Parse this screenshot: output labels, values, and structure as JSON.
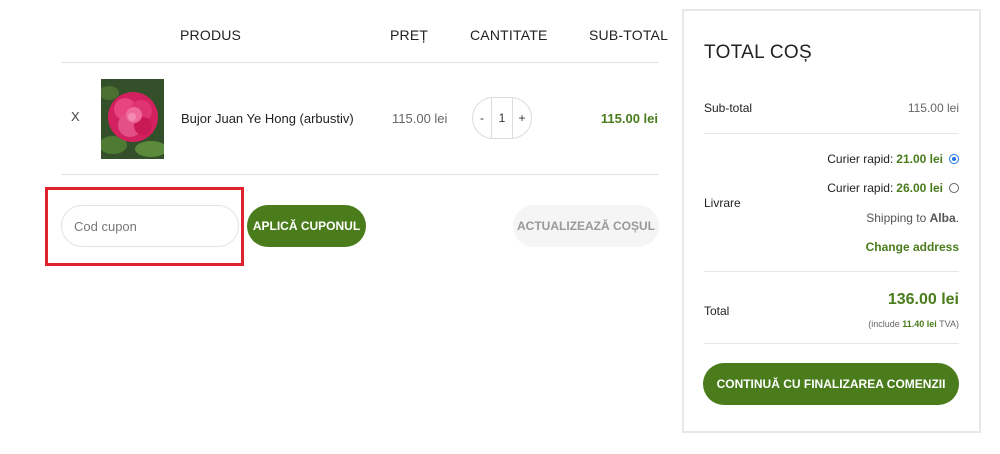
{
  "cart": {
    "headers": {
      "product": "PRODUS",
      "price": "PREȚ",
      "quantity": "CANTITATE",
      "subtotal": "SUB-TOTAL"
    },
    "items": [
      {
        "remove_label": "X",
        "image_icon": "peony-flower-photo",
        "name": "Bujor Juan Ye Hong (arbustiv)",
        "price": "115.00 lei",
        "qty_minus": "-",
        "qty": "1",
        "qty_plus": "+",
        "subtotal": "115.00 lei"
      }
    ]
  },
  "coupon": {
    "placeholder": "Cod cupon",
    "apply_label": "APLICĂ CUPONUL",
    "update_label": "ACTUALIZEAZĂ COȘUL"
  },
  "totals": {
    "title": "TOTAL COȘ",
    "subtotal_label": "Sub-total",
    "subtotal_value": "115.00 lei",
    "shipping_label": "Livrare",
    "shipping_options": [
      {
        "label": "Curier rapid:",
        "price": "21.00 lei",
        "selected": true
      },
      {
        "label": "Curier rapid:",
        "price": "26.00 lei",
        "selected": false
      }
    ],
    "shipping_to_prefix": "Shipping to",
    "shipping_to_place": "Alba",
    "shipping_to_suffix": ".",
    "change_address": "Change address",
    "total_label": "Total",
    "total_value": "136.00 lei",
    "vat_prefix": "(include",
    "vat_amount": "11.40 lei",
    "vat_suffix": "TVA)",
    "checkout_label": "CONTINUĂ CU FINALIZAREA COMENZII"
  },
  "colors": {
    "accent_green": "#4a7c1c",
    "highlight_red": "#e0222f",
    "radio_blue": "#1a73e8"
  }
}
